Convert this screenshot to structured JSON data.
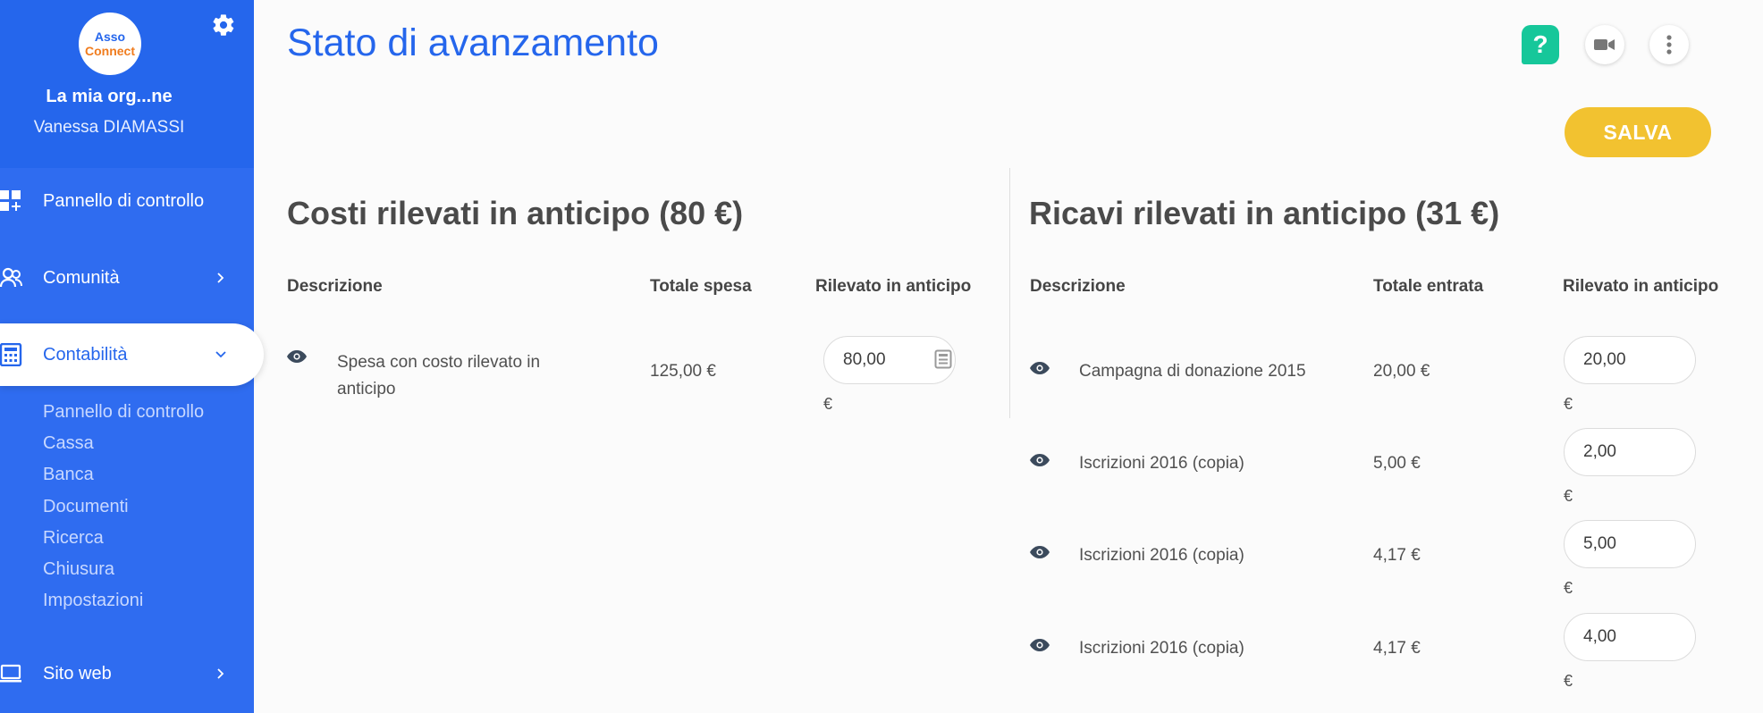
{
  "sidebar": {
    "logo_line1": "Asso",
    "logo_line2": "Connect",
    "org_name": "La mia org...ne",
    "user_name": "Vanessa DIAMASSI",
    "nav": {
      "dashboard": "Pannello di controllo",
      "community": "Comunità",
      "accounting": "Contabilità",
      "website": "Sito web"
    },
    "sub_items": [
      "Pannello di controllo",
      "Cassa",
      "Banca",
      "Documenti",
      "Ricerca",
      "Chiusura",
      "Impostazioni"
    ]
  },
  "header": {
    "title": "Stato di avanzamento",
    "help_label": "?",
    "save_label": "SALVA"
  },
  "costs": {
    "title": "Costi rilevati in anticipo (80 €)",
    "columns": {
      "description": "Descrizione",
      "total": "Totale spesa",
      "accrued": "Rilevato in anticipo"
    },
    "rows": [
      {
        "description": "Spesa con costo rilevato in anticipo",
        "total": "125,00 €",
        "accrued": "80,00",
        "currency": "€"
      }
    ]
  },
  "revenues": {
    "title": "Ricavi rilevati in anticipo (31 €)",
    "columns": {
      "description": "Descrizione",
      "total": "Totale entrata",
      "accrued": "Rilevato in anticipo"
    },
    "rows": [
      {
        "description": "Campagna di donazione 2015",
        "total": "20,00 €",
        "accrued": "20,00",
        "currency": "€"
      },
      {
        "description": "Iscrizioni 2016 (copia)",
        "total": "5,00 €",
        "accrued": "2,00",
        "currency": "€"
      },
      {
        "description": "Iscrizioni 2016 (copia)",
        "total": "4,17 €",
        "accrued": "5,00",
        "currency": "€"
      },
      {
        "description": "Iscrizioni 2016 (copia)",
        "total": "4,17 €",
        "accrued": "4,00",
        "currency": "€"
      }
    ]
  },
  "colors": {
    "primary": "#2566ec",
    "sidebar": "#2f6cf0",
    "save": "#f2c230",
    "help": "#16c79a"
  }
}
